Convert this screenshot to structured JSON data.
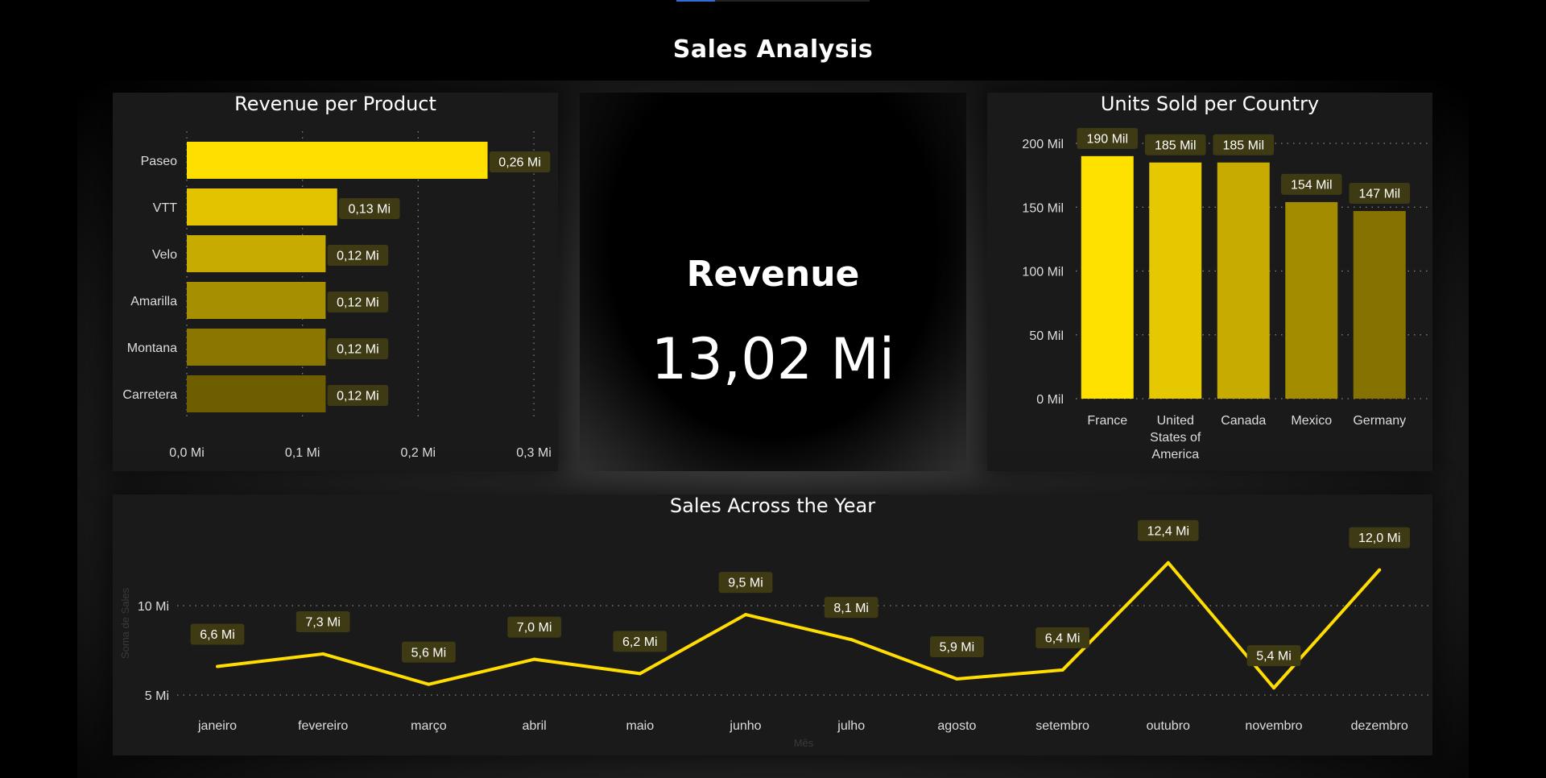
{
  "page": {
    "title": "Sales Analysis"
  },
  "kpi": {
    "label": "Revenue",
    "value": "13,02 Mi"
  },
  "colors": {
    "background": "#000000",
    "panel": "#1a1a1a",
    "label_box": "#3d3a14",
    "line": "#ffdd00"
  },
  "chart_data": [
    {
      "type": "bar",
      "orientation": "horizontal",
      "title": "Revenue per Product",
      "categories": [
        "Paseo",
        "VTT",
        "Velo",
        "Amarilla",
        "Montana",
        "Carretera"
      ],
      "values": [
        0.26,
        0.13,
        0.12,
        0.12,
        0.12,
        0.12
      ],
      "data_labels": [
        "0,26 Mi",
        "0,13 Mi",
        "0,12 Mi",
        "0,12 Mi",
        "0,12 Mi",
        "0,12 Mi"
      ],
      "bar_colors": [
        "#ffdf00",
        "#e3c300",
        "#c8ab00",
        "#a68f00",
        "#8a7600",
        "#6e5e00"
      ],
      "xlim": [
        0,
        0.3
      ],
      "x_ticks": [
        0,
        0.1,
        0.2,
        0.3
      ],
      "x_tick_labels": [
        "0,0 Mi",
        "0,1 Mi",
        "0,2 Mi",
        "0,3 Mi"
      ],
      "grid": "vertical dotted"
    },
    {
      "type": "bar",
      "title": "Units Sold per Country",
      "categories": [
        "France",
        "United States of America",
        "Canada",
        "Mexico",
        "Germany"
      ],
      "category_label_lines": [
        [
          "France"
        ],
        [
          "United",
          "States of",
          "America"
        ],
        [
          "Canada"
        ],
        [
          "Mexico"
        ],
        [
          "Germany"
        ]
      ],
      "values": [
        190,
        185,
        185,
        154,
        147
      ],
      "data_labels": [
        "190 Mil",
        "185 Mil",
        "185 Mil",
        "154 Mil",
        "147 Mil"
      ],
      "bar_colors": [
        "#ffe100",
        "#e6c800",
        "#c8ab00",
        "#a48c00",
        "#857200"
      ],
      "ylim": [
        0,
        200
      ],
      "y_ticks": [
        0,
        50,
        100,
        150,
        200
      ],
      "y_tick_labels": [
        "0 Mil",
        "50 Mil",
        "100 Mil",
        "150 Mil",
        "200 Mil"
      ],
      "grid": "horizontal dotted"
    },
    {
      "type": "line",
      "title": "Sales Across the Year",
      "xlabel": "Mês",
      "ylabel": "Soma de Sales",
      "categories": [
        "janeiro",
        "fevereiro",
        "março",
        "abril",
        "maio",
        "junho",
        "julho",
        "agosto",
        "setembro",
        "outubro",
        "novembro",
        "dezembro"
      ],
      "values": [
        6.6,
        7.3,
        5.6,
        7.0,
        6.2,
        9.5,
        8.1,
        5.9,
        6.4,
        12.4,
        5.4,
        12.0
      ],
      "data_labels": [
        "6,6 Mi",
        "7,3 Mi",
        "5,6 Mi",
        "7,0 Mi",
        "6,2 Mi",
        "9,5 Mi",
        "8,1 Mi",
        "5,9 Mi",
        "6,4 Mi",
        "12,4 Mi",
        "5,4 Mi",
        "12,0 Mi"
      ],
      "ylim": [
        5,
        10
      ],
      "y_ticks": [
        5,
        10
      ],
      "y_tick_labels": [
        "5 Mi",
        "10 Mi"
      ],
      "grid": "horizontal dotted",
      "line_color": "#ffdd00"
    }
  ]
}
